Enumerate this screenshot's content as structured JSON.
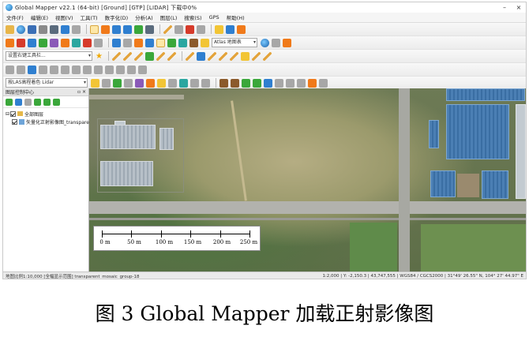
{
  "window": {
    "title": "Global Mapper v22.1 (64-bit) [Ground] [GTP] [LIDAR] 下载中0%",
    "minimize": "–",
    "close": "×"
  },
  "menu": [
    "文件(F)",
    "编辑(E)",
    "视图(V)",
    "工具(T)",
    "数字化(D)",
    "分析(A)",
    "图层(L)",
    "搜索(S)",
    "GPS",
    "帮助(H)"
  ],
  "toolbars": {
    "style_combo": "设置右键工具栏...",
    "map_theme_combo": "Atlas 地图表",
    "lidar_combo": "按LAS高程着色 Lidar"
  },
  "control_center": {
    "title": "图层控制中心",
    "pin": "▫ ×",
    "tree": [
      {
        "label": "全部图层",
        "checked": true,
        "level": 0
      },
      {
        "label": "矢量化正射影像图_transparent",
        "checked": true,
        "level": 1
      }
    ]
  },
  "scalebar": {
    "labels": [
      "0 m",
      "50 m",
      "100 m",
      "150 m",
      "200 m",
      "250 m"
    ]
  },
  "statusbar": {
    "left": "地图比例1:10,000  [全幅显示范围]  transparent_mosaic_group-18",
    "right": "1:2,000  |  Y: -2,150.3  |  43,747,555  |  WGS84 / CGCS2000  |  31°49' 26.55\" N, 104° 27' 44.97\" E"
  },
  "caption": "图 3 Global Mapper 加载正射影像图"
}
